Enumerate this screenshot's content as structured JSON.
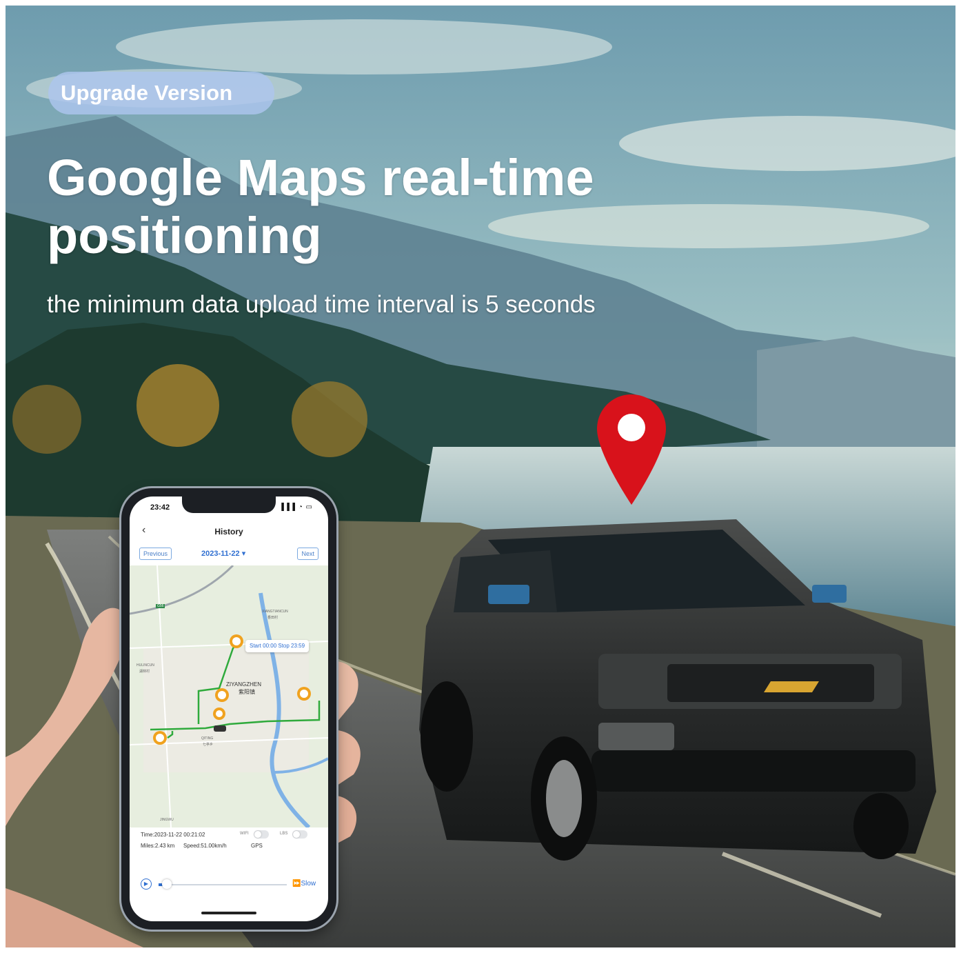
{
  "banner": {
    "badge": "Upgrade Version",
    "headline_line1": "Google Maps real-time",
    "headline_line2": "positioning",
    "subtitle": "the minimum data upload time interval is 5 seconds"
  },
  "phone": {
    "clock": "23:42",
    "status_icons": "▐▐▐ ◔ ▭",
    "back_glyph": "‹",
    "title": "History",
    "previous_label": "Previous",
    "date": "2023-11-22 ▾",
    "next_label": "Next",
    "bubble": "Start 00:00 Stop 23:59",
    "map_labels": {
      "town_main": "ZIYANGZHEN",
      "town_main_cn": "紫阳镇",
      "xiangtiancun": "XIANGTIANCUN",
      "xiangtiancun_cn": "香田村",
      "hulincun": "HULINCUN",
      "hulincun_cn": "湖林村",
      "qiting": "QITING",
      "qiting_cn": "七亭乡",
      "jingwu": "JINGWU",
      "road_number": "G56"
    },
    "parking_marker_letter": "P",
    "info": {
      "time": "Time:2023-11-22 00:21:02",
      "miles": "Miles:2.43 km",
      "speed": "Speed:51.00km/h",
      "source": "GPS",
      "wifi_label": "WIFI",
      "lbs_label": "LBS"
    },
    "playback": {
      "play_glyph": "▶",
      "speed_label": "⏩Slow",
      "progress": 0.04
    }
  },
  "colors": {
    "pin": "#d8121b",
    "route": "#2faa3c",
    "parking": "#f0a21f",
    "accent_blue": "#2f6fd1"
  }
}
